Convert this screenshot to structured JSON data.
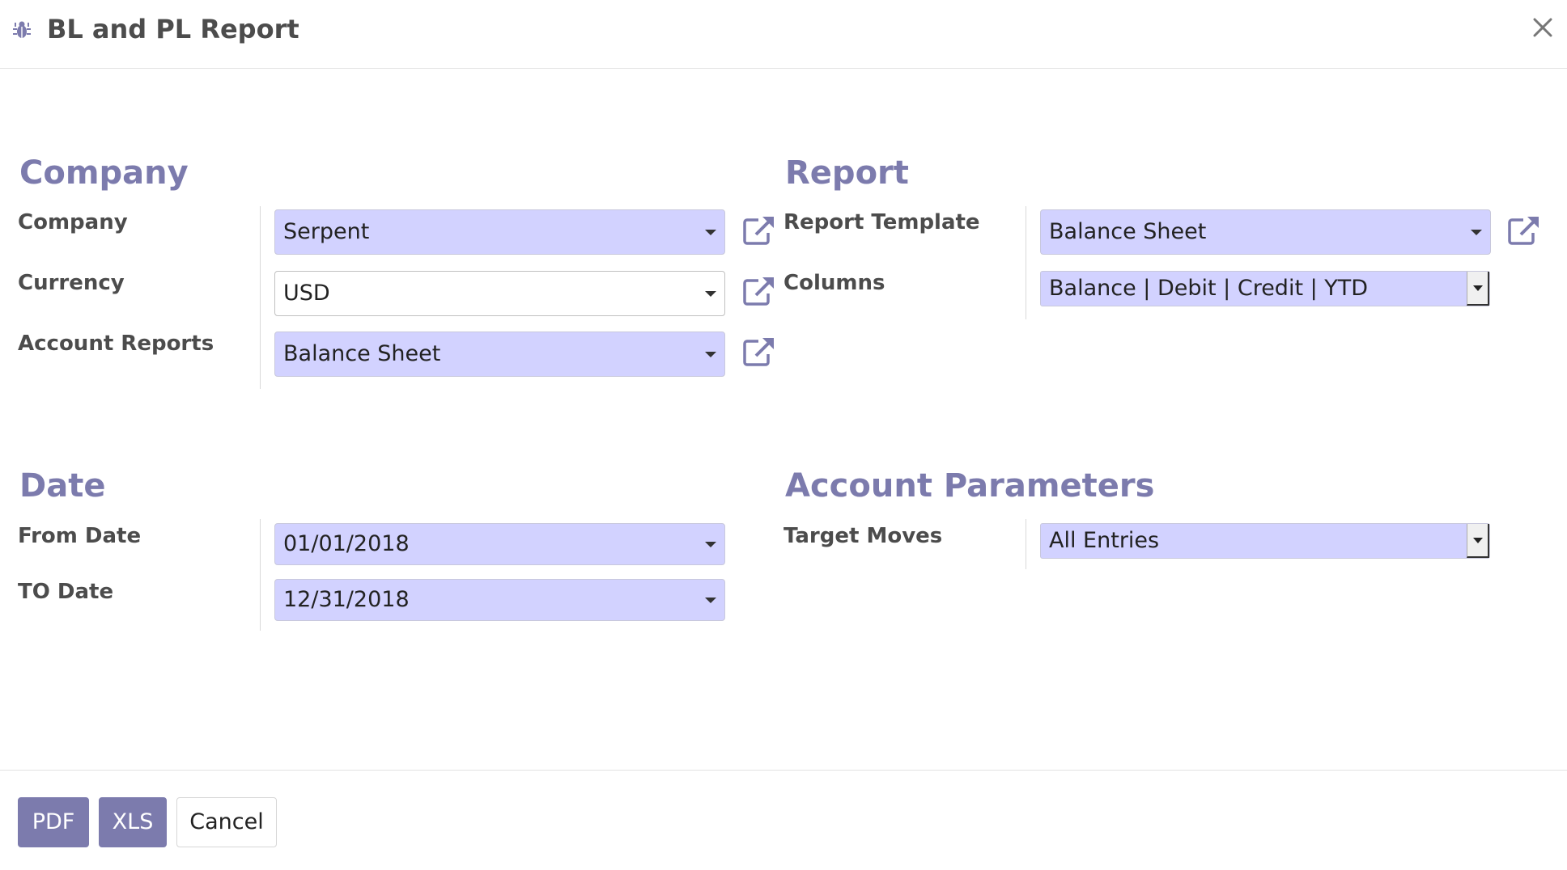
{
  "header": {
    "title": "BL and PL Report",
    "icons": {
      "debug": "bug-icon",
      "close": "close-icon"
    }
  },
  "sections": {
    "company": {
      "title": "Company",
      "fields": {
        "company": {
          "label": "Company",
          "value": "Serpent"
        },
        "currency": {
          "label": "Currency",
          "value": "USD"
        },
        "account_reports": {
          "label": "Account Reports",
          "value": "Balance Sheet"
        }
      }
    },
    "report": {
      "title": "Report",
      "fields": {
        "report_template": {
          "label": "Report Template",
          "value": "Balance Sheet"
        },
        "columns": {
          "label": "Columns",
          "value": "Balance | Debit | Credit | YTD"
        }
      }
    },
    "date": {
      "title": "Date",
      "fields": {
        "from_date": {
          "label": "From Date",
          "value": "01/01/2018"
        },
        "to_date": {
          "label": "TO Date",
          "value": "12/31/2018"
        }
      }
    },
    "account_parameters": {
      "title": "Account Parameters",
      "fields": {
        "target_moves": {
          "label": "Target Moves",
          "value": "All Entries"
        }
      }
    }
  },
  "footer": {
    "pdf_label": "PDF",
    "xls_label": "XLS",
    "cancel_label": "Cancel"
  },
  "colors": {
    "accent": "#7c7bad",
    "field_bg": "#d2d2ff",
    "text": "#4c4c4c"
  }
}
